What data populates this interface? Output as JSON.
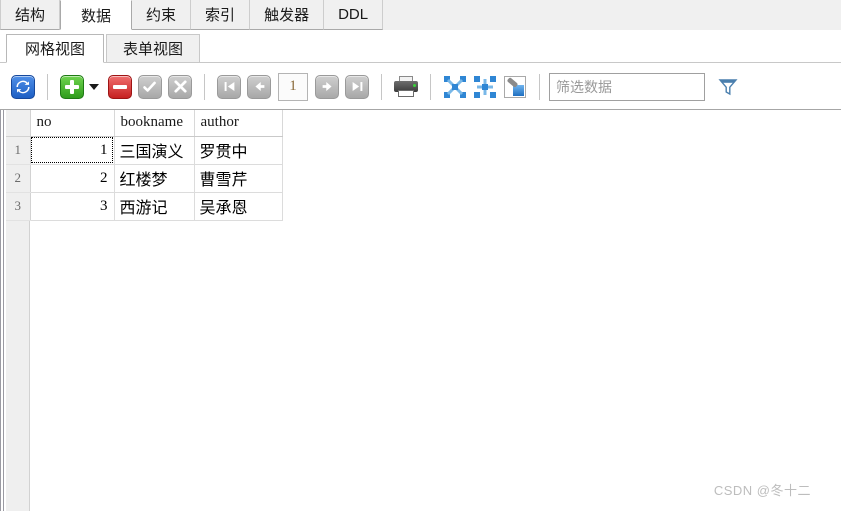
{
  "outer_tabs": [
    {
      "label": "结构",
      "active": false
    },
    {
      "label": "数据",
      "active": true
    },
    {
      "label": "约束",
      "active": false
    },
    {
      "label": "索引",
      "active": false
    },
    {
      "label": "触发器",
      "active": false
    },
    {
      "label": "DDL",
      "active": false
    }
  ],
  "inner_tabs": [
    {
      "label": "网格视图",
      "active": true
    },
    {
      "label": "表单视图",
      "active": false
    }
  ],
  "toolbar": {
    "refresh_title": "刷新",
    "add_title": "添加记录",
    "add_dropdown_title": "添加记录选项",
    "delete_title": "删除记录",
    "apply_title": "应用更改",
    "cancel_title": "取消更改",
    "first_page_title": "第一页",
    "prev_page_title": "上一页",
    "page_value": "1",
    "next_page_title": "下一页",
    "last_page_title": "最后一页",
    "print_title": "打印",
    "export1_title": "导出数据",
    "export2_title": "导入数据",
    "paint_title": "设置格式",
    "filter_placeholder": "筛选数据",
    "funnel_title": "筛选器"
  },
  "grid": {
    "columns": [
      "no",
      "bookname",
      "author"
    ],
    "row_numbers": [
      "1",
      "2",
      "3"
    ],
    "rows": [
      {
        "no": "1",
        "bookname": "三国演义",
        "author": "罗贯中",
        "focused": true
      },
      {
        "no": "2",
        "bookname": "红楼梦",
        "author": "曹雪芹",
        "focused": false
      },
      {
        "no": "3",
        "bookname": "西游记",
        "author": "吴承恩",
        "focused": false
      }
    ]
  },
  "watermark": "CSDN @冬十二",
  "colors": {
    "tab_bg": "#f0f0f0",
    "active_tab_bg": "#ffffff",
    "toolbar_bg": "#ffffff",
    "gutter_bg": "#efefef",
    "grid_line": "#dcdcdc",
    "accent_blue": "#2f86d4",
    "add_green": "#2f9c1c",
    "delete_red": "#c62020",
    "watermark": "#bdbdbd"
  }
}
